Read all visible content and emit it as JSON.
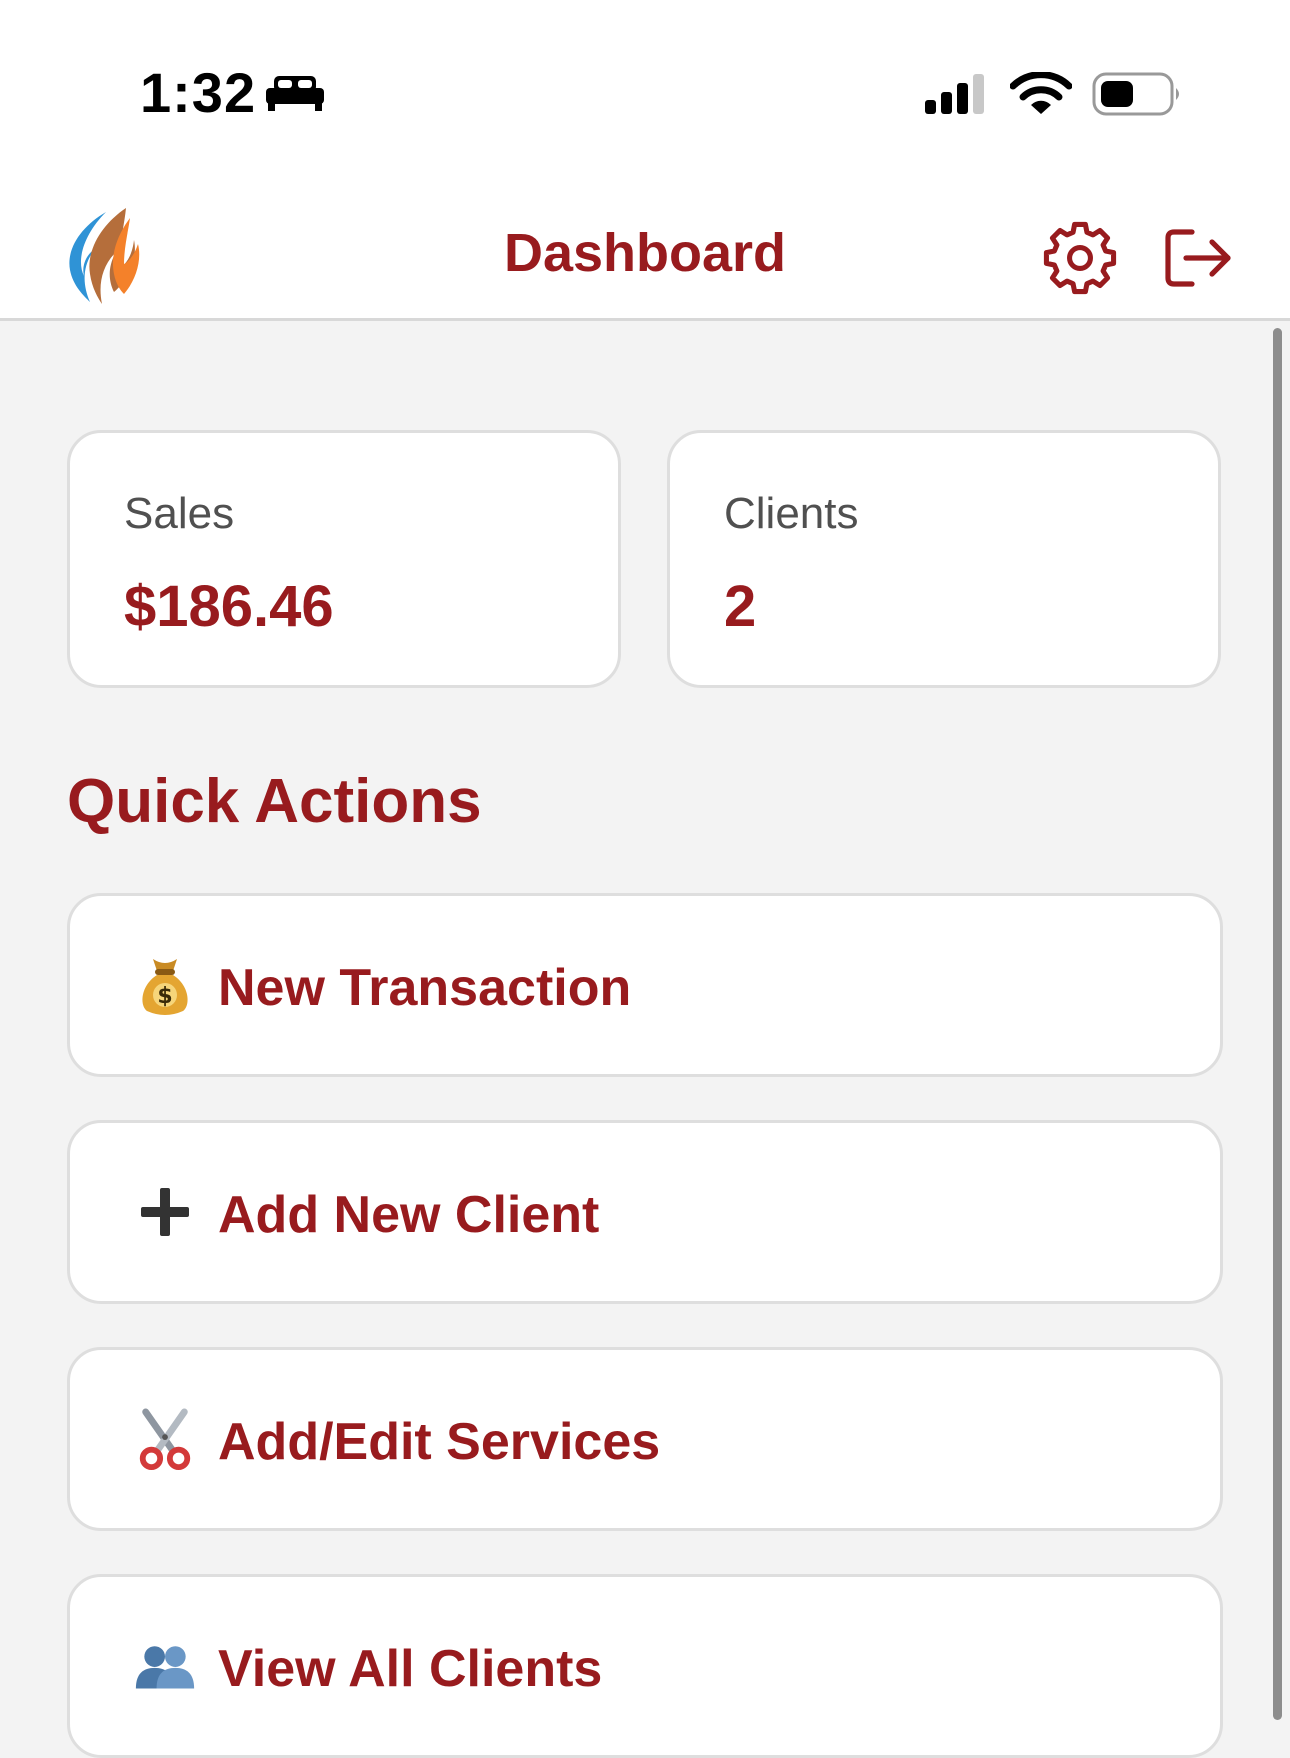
{
  "status_bar": {
    "time": "1:32",
    "sleep_icon": "bed-icon",
    "signal_icon": "cellular-signal-icon",
    "wifi_icon": "wifi-icon",
    "battery_icon": "battery-icon",
    "battery_level": 0.5
  },
  "header": {
    "logo_icon": "flame-logo-icon",
    "title": "Dashboard",
    "settings_icon": "gear-icon",
    "logout_icon": "logout-icon"
  },
  "stats": [
    {
      "label": "Sales",
      "value": "$186.46"
    },
    {
      "label": "Clients",
      "value": "2"
    }
  ],
  "quick_actions": {
    "title": "Quick Actions",
    "items": [
      {
        "icon": "money-bag-icon",
        "label": "New Transaction"
      },
      {
        "icon": "plus-icon",
        "label": "Add New Client"
      },
      {
        "icon": "scissors-icon",
        "label": "Add/Edit Services"
      },
      {
        "icon": "two-users-icon",
        "label": "View All Clients"
      }
    ]
  },
  "colors": {
    "accent": "#981b1e",
    "background": "#f3f3f3",
    "card": "#ffffff",
    "muted_text": "#505050"
  }
}
